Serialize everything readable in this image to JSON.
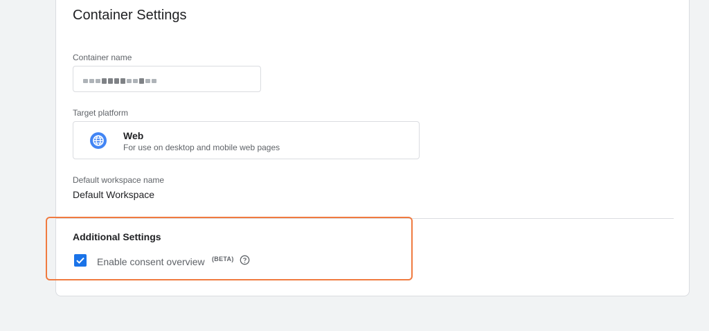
{
  "page": {
    "title": "Container Settings"
  },
  "container_name": {
    "label": "Container name",
    "value_obscured": "blurred container name"
  },
  "target_platform": {
    "label": "Target platform",
    "option_title": "Web",
    "option_description": "For use on desktop and mobile web pages",
    "icon": "globe-icon"
  },
  "workspace": {
    "label": "Default workspace name",
    "value": "Default Workspace"
  },
  "additional_settings": {
    "title": "Additional Settings",
    "consent_checkbox_label": "Enable consent overview",
    "consent_badge": "(BETA)",
    "consent_checked": true,
    "help_icon": "help-circle-icon"
  },
  "colors": {
    "accent": "#1a73e8",
    "highlight_border": "#f07a3f",
    "background": "#f1f3f4"
  }
}
